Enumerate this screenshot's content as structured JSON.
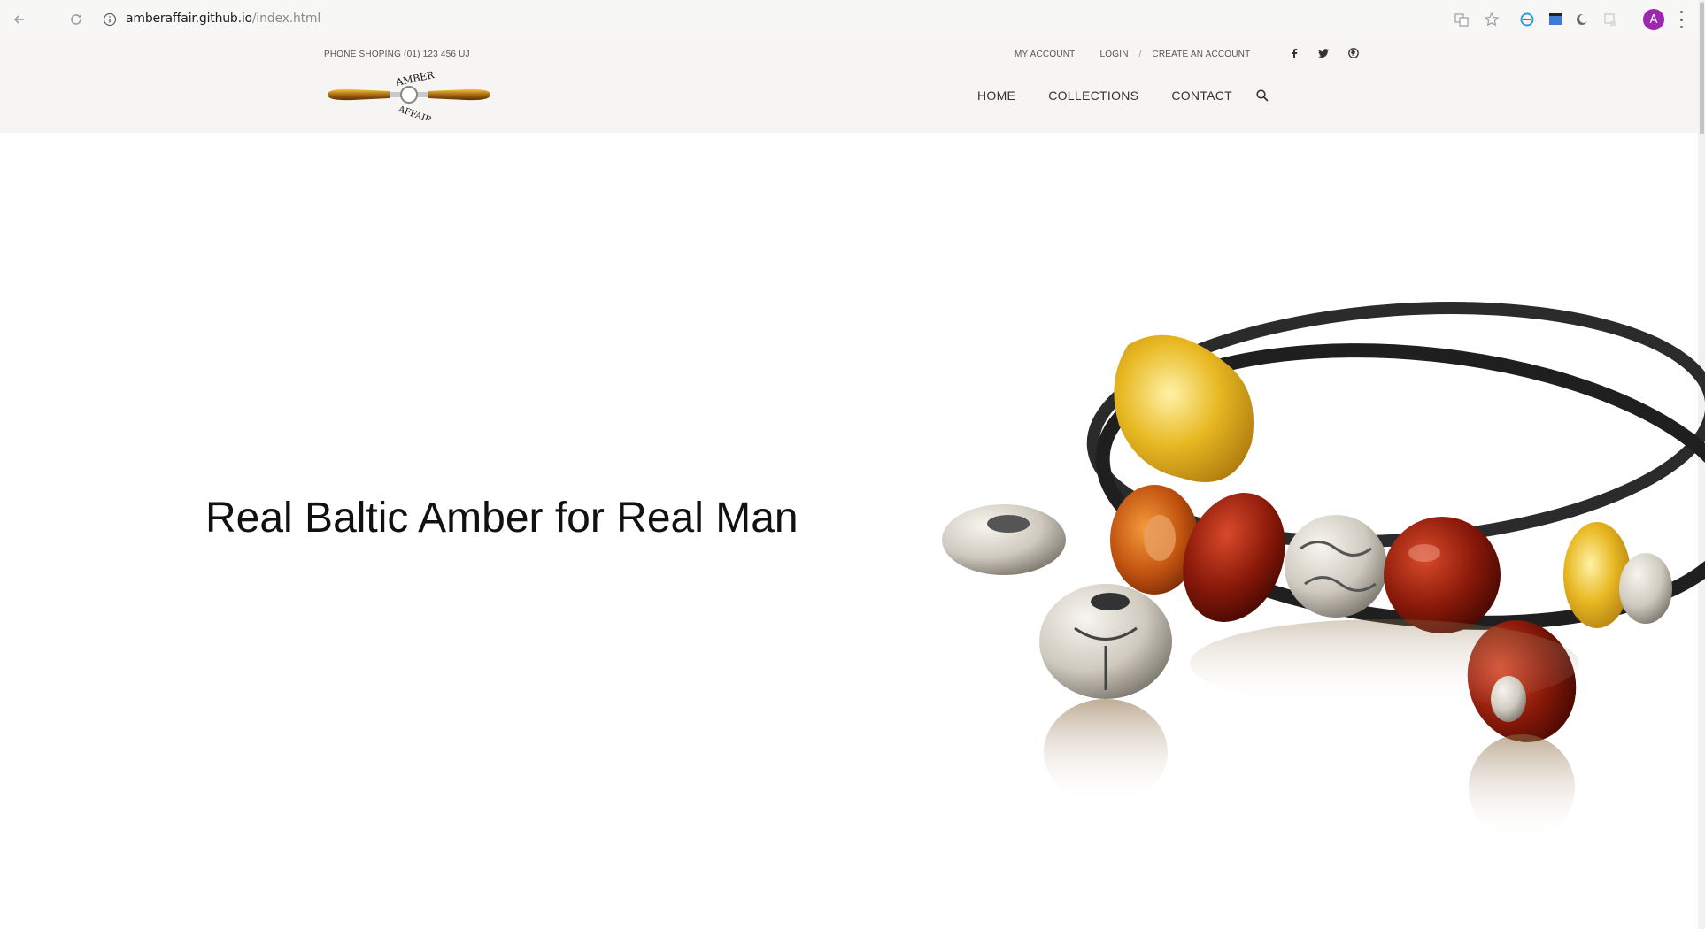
{
  "browser": {
    "url_host": "amberaffair.github.io",
    "url_path": "/index.html",
    "profile_initial": "A"
  },
  "header": {
    "phone_text": "PHONE SHOPING (01) 123 456 UJ",
    "logo_text": "AMBER AFFAIR",
    "top_links": {
      "my_account": "MY ACCOUNT",
      "login": "LOGIN",
      "separator": "/",
      "create_account": "CREATE AN ACCOUNT"
    },
    "social_icons": [
      "facebook-icon",
      "twitter-icon",
      "pinterest-icon"
    ],
    "nav": [
      "HOME",
      "COLLECTIONS",
      "CONTACT"
    ]
  },
  "hero": {
    "heading": "Real Baltic Amber for Real Man"
  },
  "colors": {
    "amber_light": "#e8b923",
    "amber_dark": "#8b1a0a",
    "cord": "#2b2b2b",
    "silver": "#d9d6cf",
    "avatar": "#9c27b0"
  }
}
